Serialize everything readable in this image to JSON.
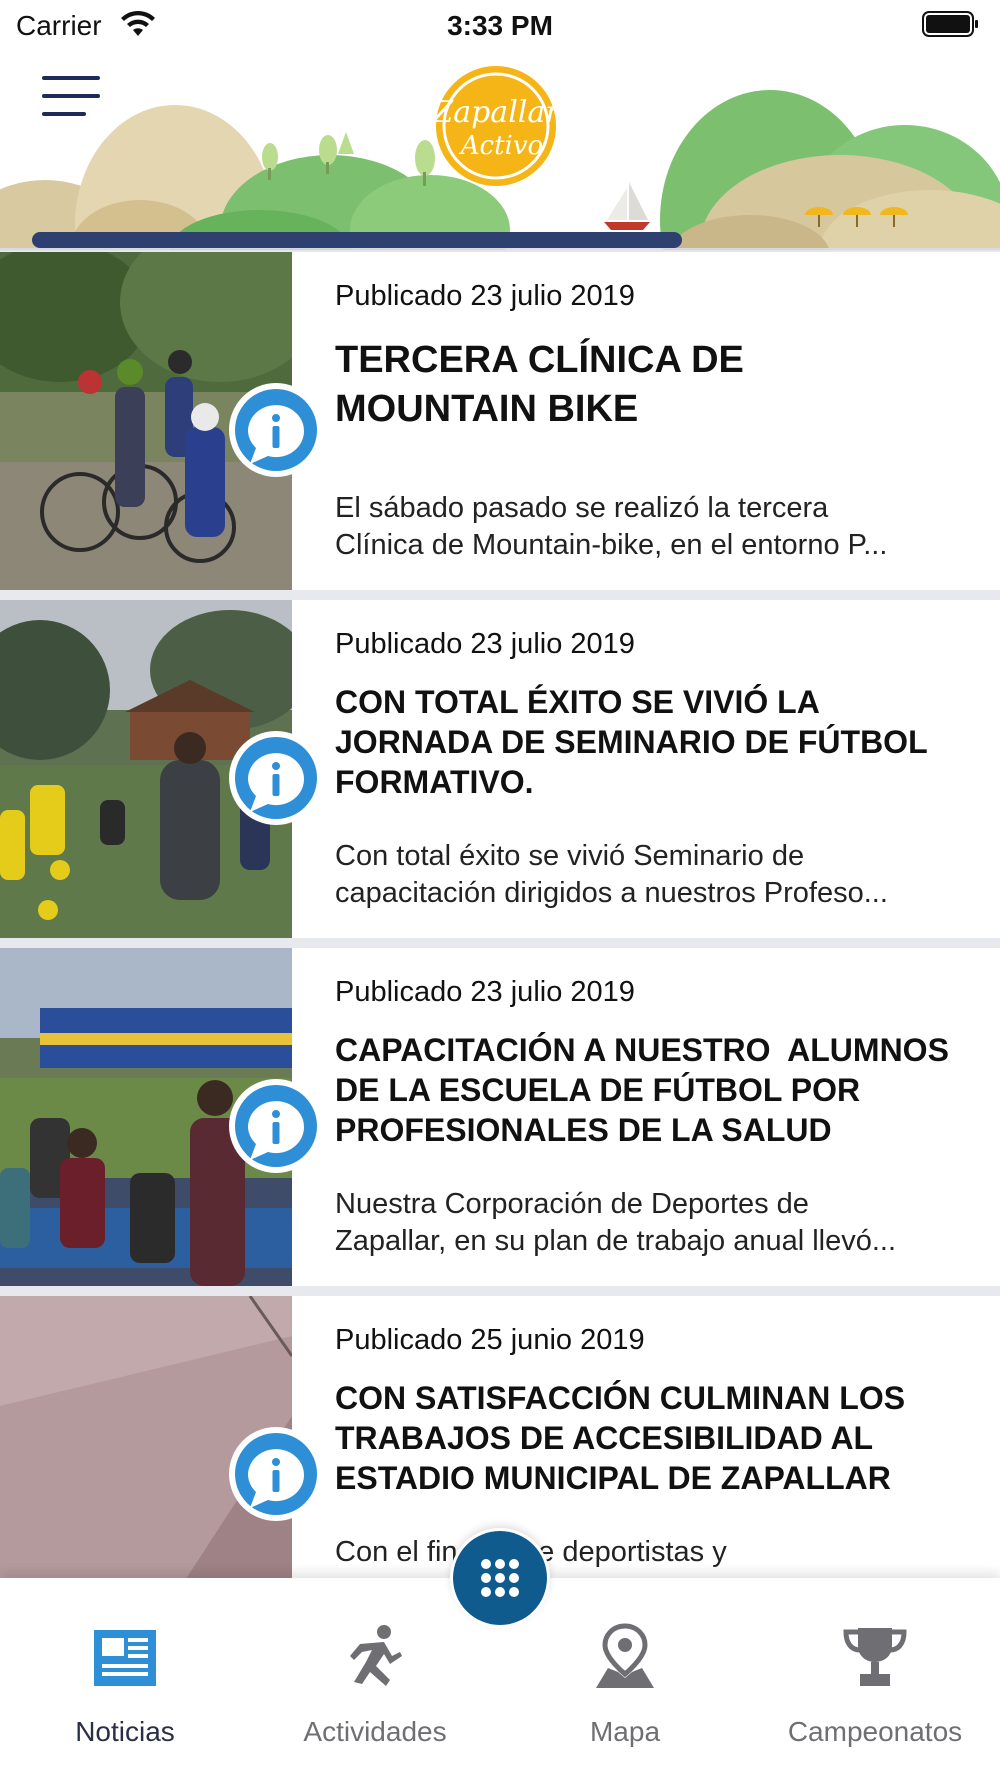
{
  "status_bar": {
    "carrier": "Carrier",
    "time": "3:33 PM"
  },
  "header": {
    "logo_line1": "Zapallar",
    "logo_line2": "Activo"
  },
  "colors": {
    "accent_blue": "#2e8fd6",
    "dark_blue": "#105b8e",
    "logo_yellow": "#f5b516",
    "navy": "#1e2a5a"
  },
  "news": [
    {
      "date": "Publicado 23 julio 2019",
      "title_lines": [
        "TERCERA CLÍNICA DE",
        "MOUNTAIN BIKE"
      ],
      "excerpt_lines": [
        "El sábado pasado se realizó la tercera",
        "Clínica de Mountain-bike, en el entorno P..."
      ]
    },
    {
      "date": "Publicado 23 julio 2019",
      "title_lines": [
        "CON TOTAL ÉXITO SE VIVIÓ LA",
        "JORNADA DE SEMINARIO DE FÚTBOL",
        "FORMATIVO."
      ],
      "excerpt_lines": [
        "Con total éxito se vivió Seminario de",
        "capacitación dirigidos a nuestros Profeso..."
      ]
    },
    {
      "date": "Publicado 23 julio 2019",
      "title_lines": [
        "CAPACITACIÓN A NUESTRO  ALUMNOS",
        "DE LA ESCUELA DE FÚTBOL POR",
        "PROFESIONALES DE LA SALUD"
      ],
      "excerpt_lines": [
        "Nuestra Corporación de Deportes de",
        "Zapallar, en su plan de trabajo anual llevó..."
      ]
    },
    {
      "date": "Publicado 25 junio 2019",
      "title_lines": [
        "CON SATISFACCIÓN CULMINAN LOS",
        "TRABAJOS DE ACCESIBILIDAD AL",
        "ESTADIO MUNICIPAL DE ZAPALLAR"
      ],
      "excerpt_lines": [
        "Con el fin de que deportistas y",
        ""
      ]
    }
  ],
  "tabs": [
    {
      "label": "Noticias",
      "icon": "newspaper-icon",
      "active": true
    },
    {
      "label": "Actividades",
      "icon": "runner-icon",
      "active": false
    },
    {
      "label": "Mapa",
      "icon": "map-pin-icon",
      "active": false
    },
    {
      "label": "Campeonatos",
      "icon": "trophy-icon",
      "active": false
    }
  ]
}
